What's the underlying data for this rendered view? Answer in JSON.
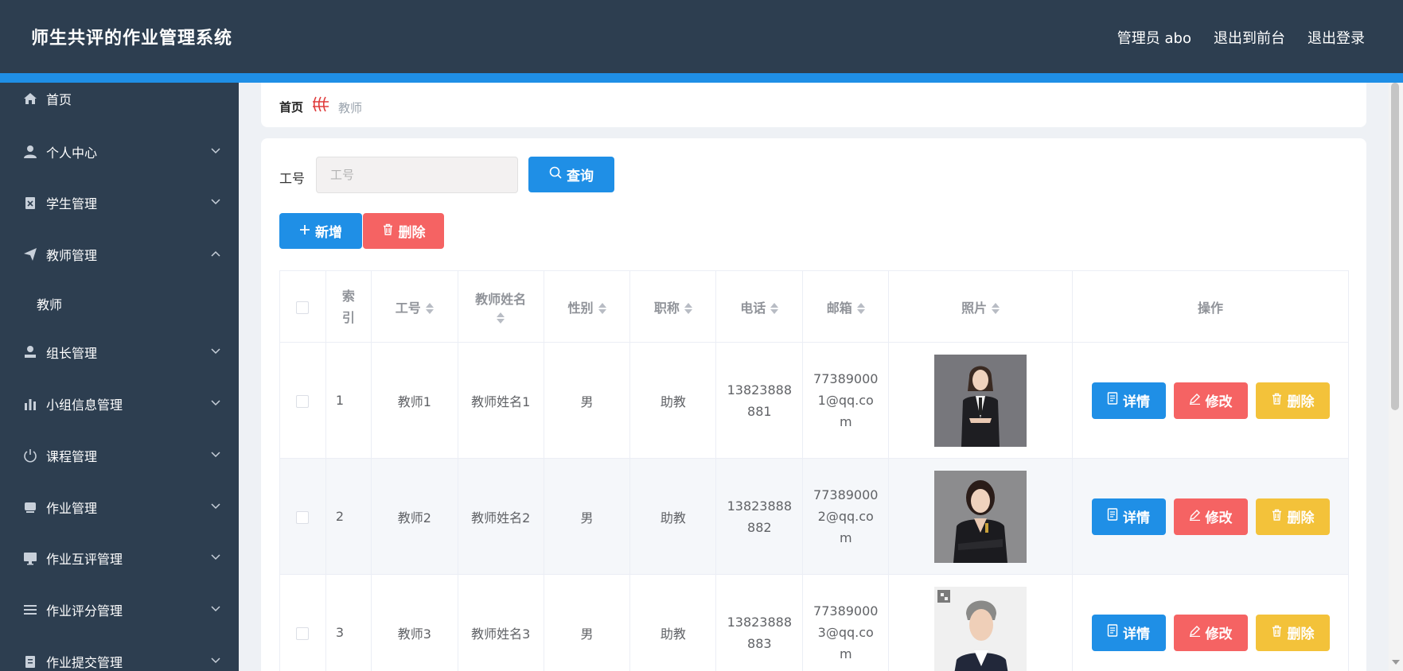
{
  "header": {
    "title": "师生共评的作业管理系统",
    "user": "管理员 abo",
    "to_front": "退出到前台",
    "logout": "退出登录"
  },
  "sidebar": {
    "items": [
      {
        "label": "首页",
        "icon": "home-icon",
        "expanded": null
      },
      {
        "label": "个人中心",
        "icon": "user-icon",
        "expanded": false
      },
      {
        "label": "学生管理",
        "icon": "clipboard-icon",
        "expanded": false
      },
      {
        "label": "教师管理",
        "icon": "paper-plane-icon",
        "expanded": true
      },
      {
        "label": "组长管理",
        "icon": "user-stamp-icon",
        "expanded": false
      },
      {
        "label": "小组信息管理",
        "icon": "bar-chart-icon",
        "expanded": false
      },
      {
        "label": "课程管理",
        "icon": "power-icon",
        "expanded": false
      },
      {
        "label": "作业管理",
        "icon": "inbox-icon",
        "expanded": false
      },
      {
        "label": "作业互评管理",
        "icon": "monitor-icon",
        "expanded": false
      },
      {
        "label": "作业评分管理",
        "icon": "list-icon",
        "expanded": false
      },
      {
        "label": "作业提交管理",
        "icon": "clipboard-list-icon",
        "expanded": false
      }
    ],
    "sub_item": "教师"
  },
  "breadcrumb": {
    "home": "首页",
    "current": "教师"
  },
  "search": {
    "label": "工号",
    "placeholder": "工号",
    "value": "",
    "button": "查询"
  },
  "toolbar": {
    "add": "新增",
    "delete": "删除"
  },
  "table": {
    "headers": {
      "index": "索引",
      "id": "工号",
      "name": "教师姓名",
      "gender": "性别",
      "title": "职称",
      "phone": "电话",
      "email": "邮箱",
      "photo": "照片",
      "actions": "操作"
    },
    "rows": [
      {
        "index": "1",
        "id": "教师1",
        "name": "教师姓名1",
        "gender": "男",
        "title": "助教",
        "phone_a": "13823888",
        "phone_b": "881",
        "email_a": "77389000",
        "email_b": "1@qq.co",
        "email_c": "m"
      },
      {
        "index": "2",
        "id": "教师2",
        "name": "教师姓名2",
        "gender": "男",
        "title": "助教",
        "phone_a": "13823888",
        "phone_b": "882",
        "email_a": "77389000",
        "email_b": "2@qq.co",
        "email_c": "m"
      },
      {
        "index": "3",
        "id": "教师3",
        "name": "教师姓名3",
        "gender": "男",
        "title": "助教",
        "phone_a": "13823888",
        "phone_b": "883",
        "email_a": "77389000",
        "email_b": "3@qq.co",
        "email_c": "m"
      }
    ],
    "actions": {
      "detail": "详情",
      "edit": "修改",
      "delete": "删除"
    }
  },
  "colors": {
    "header_bg": "#2d3e50",
    "accent": "#1f8fe6",
    "danger": "#f56363",
    "warning": "#f3c23a"
  }
}
